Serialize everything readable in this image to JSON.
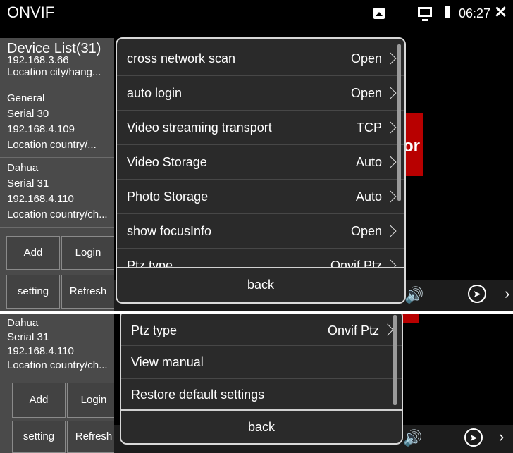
{
  "status_bar": {
    "app_title": "ONVIF",
    "time": "06:27"
  },
  "device_panel": {
    "header": "Device List(31)",
    "top_partial": {
      "ip": "192.168.3.66",
      "location": "Location city/hang..."
    },
    "devices": [
      {
        "name": "General",
        "serial": "Serial 30",
        "ip": "192.168.4.109",
        "location": "Location country/..."
      },
      {
        "name": "Dahua",
        "serial": "Serial 31",
        "ip": "192.168.4.110",
        "location": "Location country/ch..."
      }
    ],
    "buttons": {
      "add": "Add",
      "login": "Login",
      "setting": "setting",
      "refresh": "Refresh"
    }
  },
  "video_area": {
    "tile_partial_text": "or"
  },
  "settings_menu": {
    "items": [
      {
        "label": "cross network scan",
        "value": "Open"
      },
      {
        "label": "auto login",
        "value": "Open"
      },
      {
        "label": "Video streaming transport",
        "value": "TCP"
      },
      {
        "label": "Video Storage",
        "value": "Auto"
      },
      {
        "label": "Photo Storage",
        "value": "Auto"
      },
      {
        "label": "show focusInfo",
        "value": "Open"
      },
      {
        "label": "Ptz type",
        "value": "Onvif Ptz"
      },
      {
        "label": "View manual",
        "value": ""
      },
      {
        "label": "Restore default settings",
        "value": ""
      }
    ],
    "back_label": "back"
  },
  "icons": [
    "image-icon",
    "monitor-icon",
    "battery-icon",
    "close-icon",
    "speaker-icon",
    "play-circle-icon",
    "chevron-right-icon"
  ],
  "colors": {
    "panel": "#4a4a4a",
    "dialog": "#2a2a2a",
    "tile_red": "#b80000"
  }
}
